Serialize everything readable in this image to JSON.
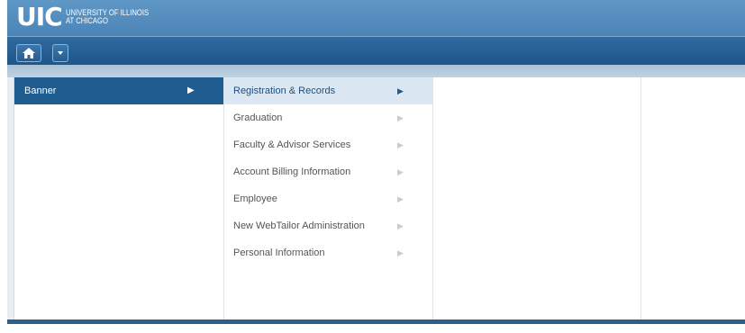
{
  "header": {
    "logo_mark": "UIC",
    "logo_line1": "UNIVERSITY OF ILLINOIS",
    "logo_line2": "AT CHICAGO"
  },
  "toolbar": {
    "home_icon": "home-icon",
    "dropdown_icon": "caret-down-icon"
  },
  "menu": {
    "level1": [
      {
        "label": "Banner",
        "active": true
      }
    ],
    "level2": [
      {
        "label": "Registration & Records",
        "active": true
      },
      {
        "label": "Graduation"
      },
      {
        "label": "Faculty & Advisor Services"
      },
      {
        "label": "Account Billing Information"
      },
      {
        "label": "Employee"
      },
      {
        "label": "New WebTailor Administration"
      },
      {
        "label": "Personal Information"
      }
    ]
  },
  "colors": {
    "header": "#5f97c6",
    "toolbar": "#1d5589",
    "active_primary": "#1f5c8f",
    "active_secondary": "#dbe7f3"
  }
}
